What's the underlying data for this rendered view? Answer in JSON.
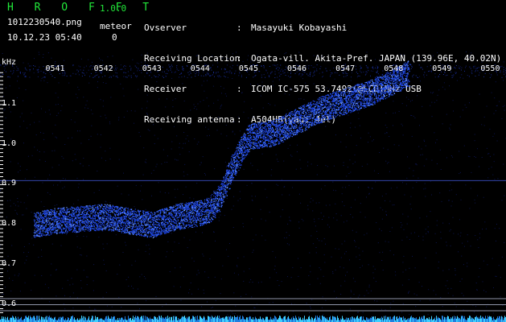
{
  "header": {
    "app_name": "H R O F F T",
    "version": "1.0.0",
    "filename": "1012230540.png",
    "datetime": "10.12.23 05:40",
    "meteor_label": "meteor",
    "meteor_count": "0"
  },
  "info": {
    "observer_label": "Ovserver",
    "observer": "Masayuki Kobayashi",
    "location_label": "Receiving Location",
    "location": "Ogata-vill. Akita-Pref. JAPAN (139.96E, 40.02N)",
    "receiver_label": "Receiver",
    "receiver": "ICOM IC-575 53.7492(@LCD)MHz USB",
    "antenna_label": "Receiving antenna",
    "antenna": "A504HB(yagi 4el)",
    "separator": ":"
  },
  "colors": {
    "title_green": "#22e83a",
    "signal_blue": "#2a5cff",
    "grid": "#4a5bb0",
    "background": "#000000"
  },
  "chart_data": {
    "type": "heatmap",
    "ylabel": "kHz",
    "y_ticks": [
      "1.1",
      "1.0",
      "0.9",
      "0.8",
      "0.7",
      "0.6"
    ],
    "y_tick_values": [
      1.1,
      1.0,
      0.9,
      0.8,
      0.7,
      0.6
    ],
    "ylim": [
      0.58,
      1.19
    ],
    "time_ticks": [
      "0541",
      "0542",
      "0543",
      "0544",
      "0545",
      "0546",
      "0547",
      "0548",
      "0549",
      "0550"
    ],
    "time_tick_values": [
      5.41,
      5.42,
      5.43,
      5.44,
      5.45,
      5.46,
      5.47,
      5.48,
      5.49,
      5.5
    ],
    "xlim": [
      5.4,
      5.503
    ],
    "reference_line_khz": 0.91,
    "signal_trace": {
      "time": [
        5.4055,
        5.41,
        5.415,
        5.42,
        5.425,
        5.43,
        5.435,
        5.44,
        5.442,
        5.444,
        5.446,
        5.448,
        5.45,
        5.455,
        5.46,
        5.465,
        5.47,
        5.475,
        5.48,
        5.483
      ],
      "freq_khz": [
        0.8,
        0.81,
        0.815,
        0.82,
        0.81,
        0.8,
        0.82,
        0.83,
        0.84,
        0.87,
        0.93,
        0.98,
        1.02,
        1.03,
        1.06,
        1.09,
        1.11,
        1.13,
        1.16,
        1.18
      ]
    },
    "lower_lines_khz": [
      0.615,
      0.6,
      0.585
    ]
  }
}
